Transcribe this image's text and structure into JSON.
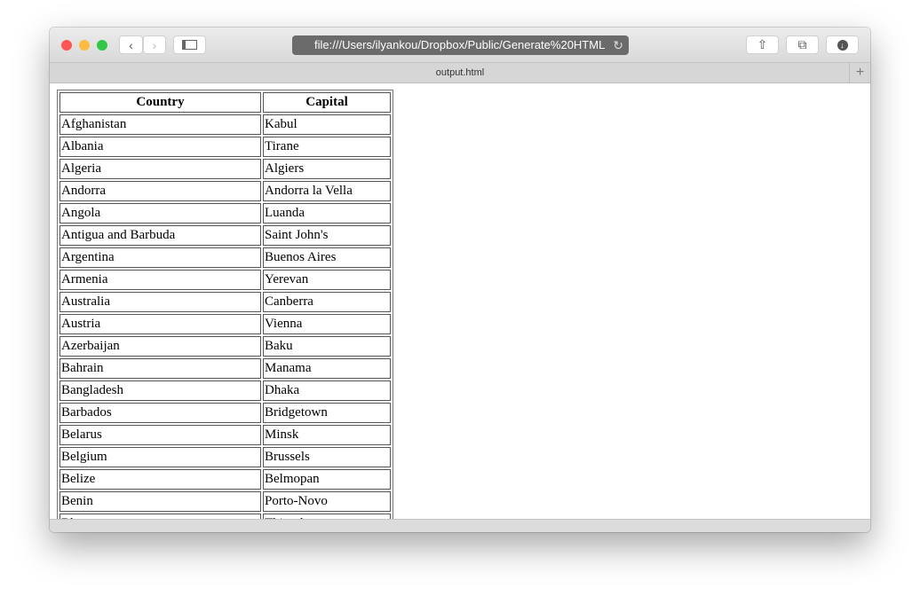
{
  "browser": {
    "url": "file:///Users/ilyankou/Dropbox/Public/Generate%20HTML",
    "tab_title": "output.html",
    "colors": {
      "close": "#fc5753",
      "minimize": "#fdbc40",
      "zoom": "#33c748"
    }
  },
  "table": {
    "headers": [
      "Country",
      "Capital"
    ],
    "rows": [
      [
        "Afghanistan",
        "Kabul"
      ],
      [
        "Albania",
        "Tirane"
      ],
      [
        "Algeria",
        "Algiers"
      ],
      [
        "Andorra",
        "Andorra la Vella"
      ],
      [
        "Angola",
        "Luanda"
      ],
      [
        "Antigua and Barbuda",
        "Saint John's"
      ],
      [
        "Argentina",
        "Buenos Aires"
      ],
      [
        "Armenia",
        "Yerevan"
      ],
      [
        "Australia",
        "Canberra"
      ],
      [
        "Austria",
        "Vienna"
      ],
      [
        "Azerbaijan",
        "Baku"
      ],
      [
        "Bahrain",
        "Manama"
      ],
      [
        "Bangladesh",
        "Dhaka"
      ],
      [
        "Barbados",
        "Bridgetown"
      ],
      [
        "Belarus",
        "Minsk"
      ],
      [
        "Belgium",
        "Brussels"
      ],
      [
        "Belize",
        "Belmopan"
      ],
      [
        "Benin",
        "Porto-Novo"
      ],
      [
        "Bhutan",
        "Thimphu"
      ]
    ]
  }
}
